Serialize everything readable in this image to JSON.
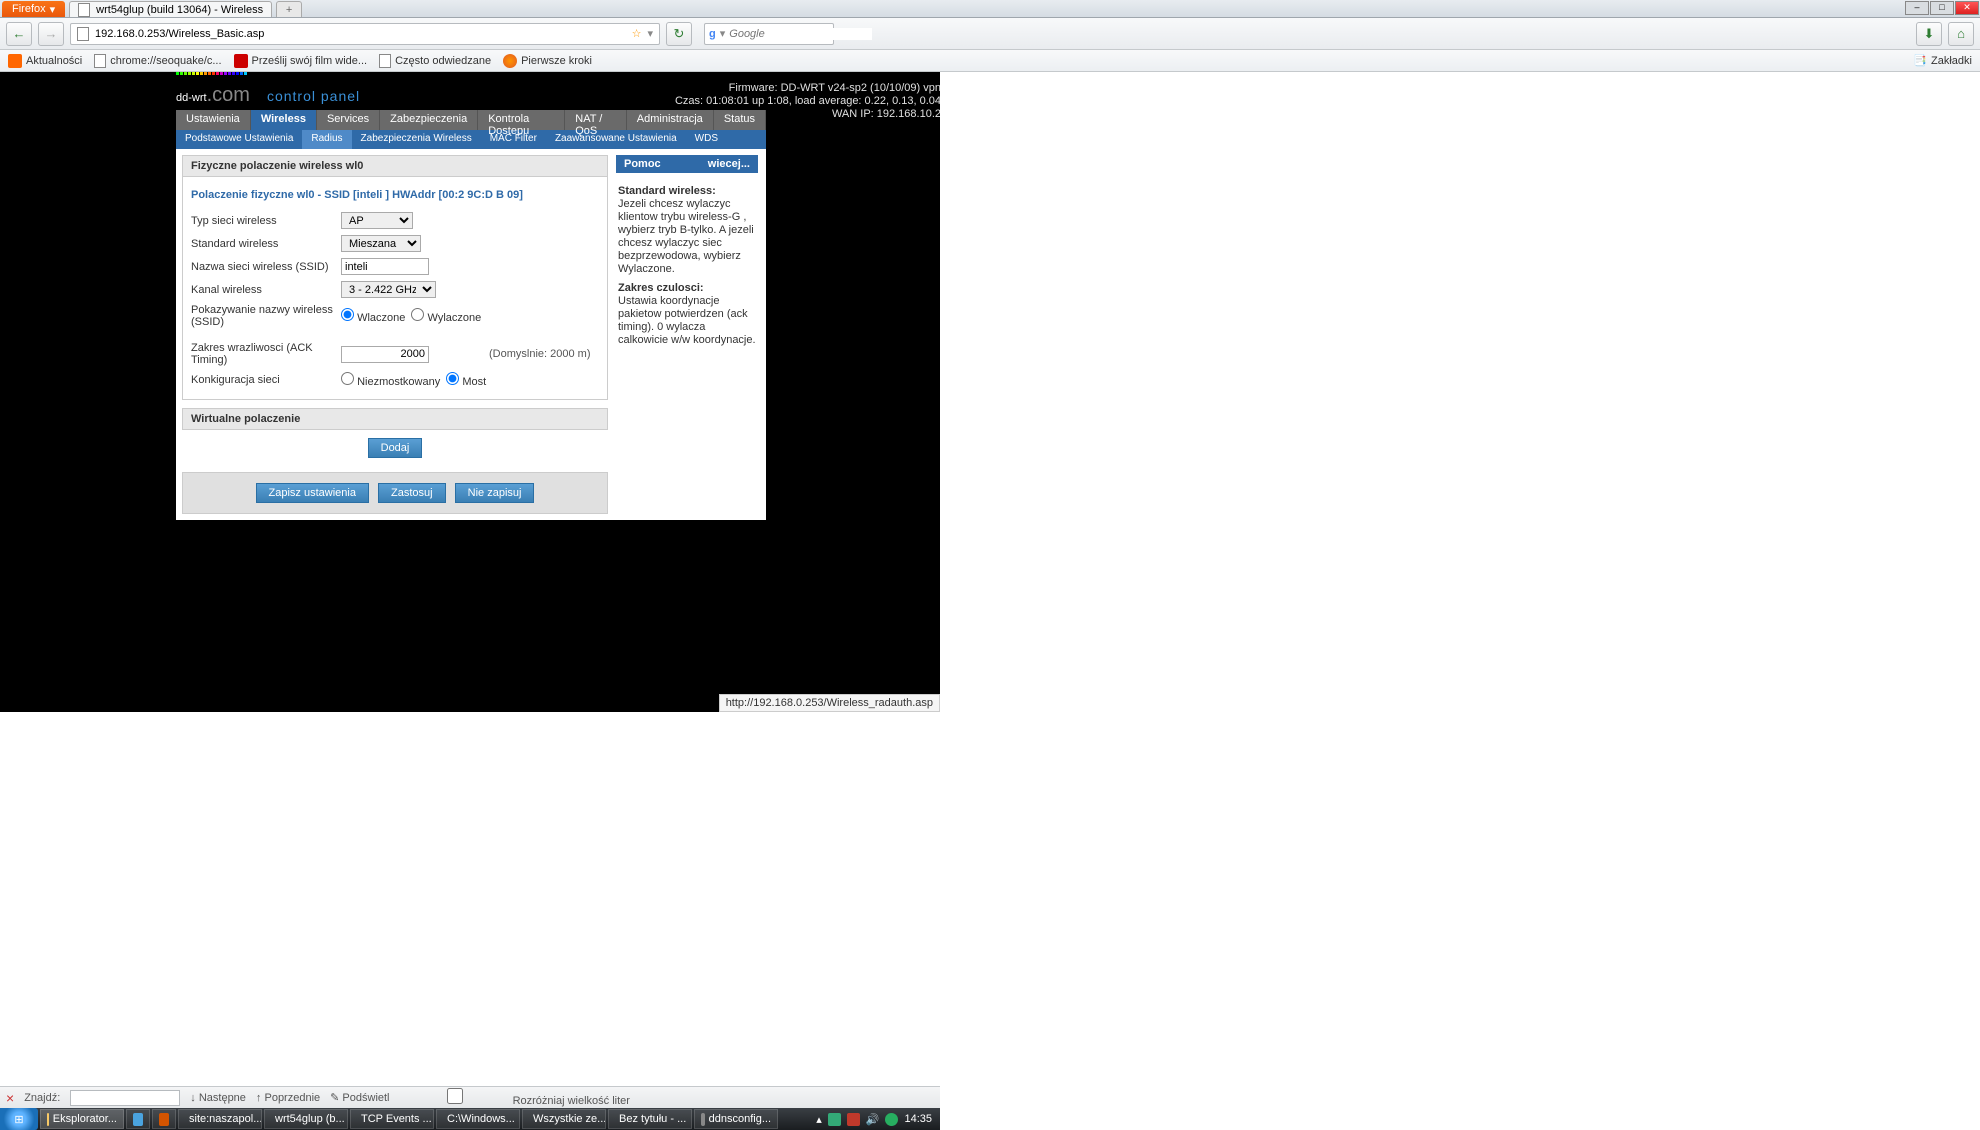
{
  "browser": {
    "app": "Firefox",
    "tab_title": "wrt54glup (build 13064) - Wireless",
    "url": "192.168.0.253/Wireless_Basic.asp",
    "search_placeholder": "Google",
    "bookmarks_label": "Zakładki",
    "bookmarks": [
      "Aktualności",
      "chrome://seoquake/c...",
      "Prześlij swój film wide...",
      "Często odwiedzane",
      "Pierwsze kroki"
    ]
  },
  "sysinfo": {
    "fw": "Firmware: DD-WRT v24-sp2 (10/10/09) vpn",
    "time": "Czas: 01:08:01 up 1:08, load average: 0.22, 0.13, 0.04",
    "wan": "WAN IP: 192.168.10.2"
  },
  "logo": {
    "brand": "dd-wrt",
    "suffix": ".com",
    "cp": "control panel"
  },
  "main_tabs": [
    "Ustawienia",
    "Wireless",
    "Services",
    "Zabezpieczenia",
    "Kontrola Dostepu",
    "NAT / QoS",
    "Administracja",
    "Status"
  ],
  "sub_tabs": [
    "Podstawowe Ustawienia",
    "Radius",
    "Zabezpieczenia Wireless",
    "MAC Filter",
    "Zaawansowane Ustawienia",
    "WDS"
  ],
  "section1": {
    "title": "Fizyczne polaczenie wireless wl0",
    "subtitle": "Polaczenie fizyczne wl0 - SSID [inteli   ] HWAddr [00:2   9C:D   B   09]",
    "rows": {
      "type_lbl": "Typ sieci wireless",
      "type_val": "AP",
      "std_lbl": "Standard wireless",
      "std_val": "Mieszana",
      "ssid_lbl": "Nazwa sieci wireless (SSID)",
      "ssid_val": "inteli",
      "ch_lbl": "Kanal wireless",
      "ch_val": "3 - 2.422 GHz",
      "bcast_lbl": "Pokazywanie nazwy wireless (SSID)",
      "bcast_on": "Wlaczone",
      "bcast_off": "Wylaczone",
      "ack_lbl": "Zakres wrazliwosci (ACK Timing)",
      "ack_val": "2000",
      "ack_hint": "(Domyslnie: 2000 m)",
      "net_lbl": "Konkiguracja sieci",
      "net_a": "Niezmostkowany",
      "net_b": "Most"
    }
  },
  "section2": {
    "title": "Wirtualne polaczenie",
    "add": "Dodaj"
  },
  "buttons": {
    "save": "Zapisz ustawienia",
    "apply": "Zastosuj",
    "cancel": "Nie zapisuj"
  },
  "help": {
    "title": "Pomoc",
    "more": "wiecej...",
    "h1": "Standard wireless:",
    "p1": "Jezeli chcesz wylaczyc klientow trybu wireless-G , wybierz tryb B-tylko. A jezeli chcesz wylaczyc siec bezprzewodowa, wybierz Wylaczone.",
    "h2": "Zakres czulosci:",
    "p2": "Ustawia koordynacje pakietow potwierdzen (ack timing). 0 wylacza calkowicie w/w koordynacje."
  },
  "status_hint": "http://192.168.0.253/Wireless_radauth.asp",
  "findbar": {
    "close": "×",
    "label": "Znajdź:",
    "next": "Następne",
    "prev": "Poprzednie",
    "hl": "Podświetl",
    "case": "Rozróżniaj wielkość liter"
  },
  "taskbar": {
    "items": [
      "Eksplorator...",
      "",
      "",
      "site:naszapol...",
      "wrt54glup (b...",
      "TCP Events ...",
      "C:\\Windows...",
      "Wszystkie ze...",
      "Bez tytułu - ...",
      "ddnsconfig..."
    ],
    "time": "14:35"
  }
}
